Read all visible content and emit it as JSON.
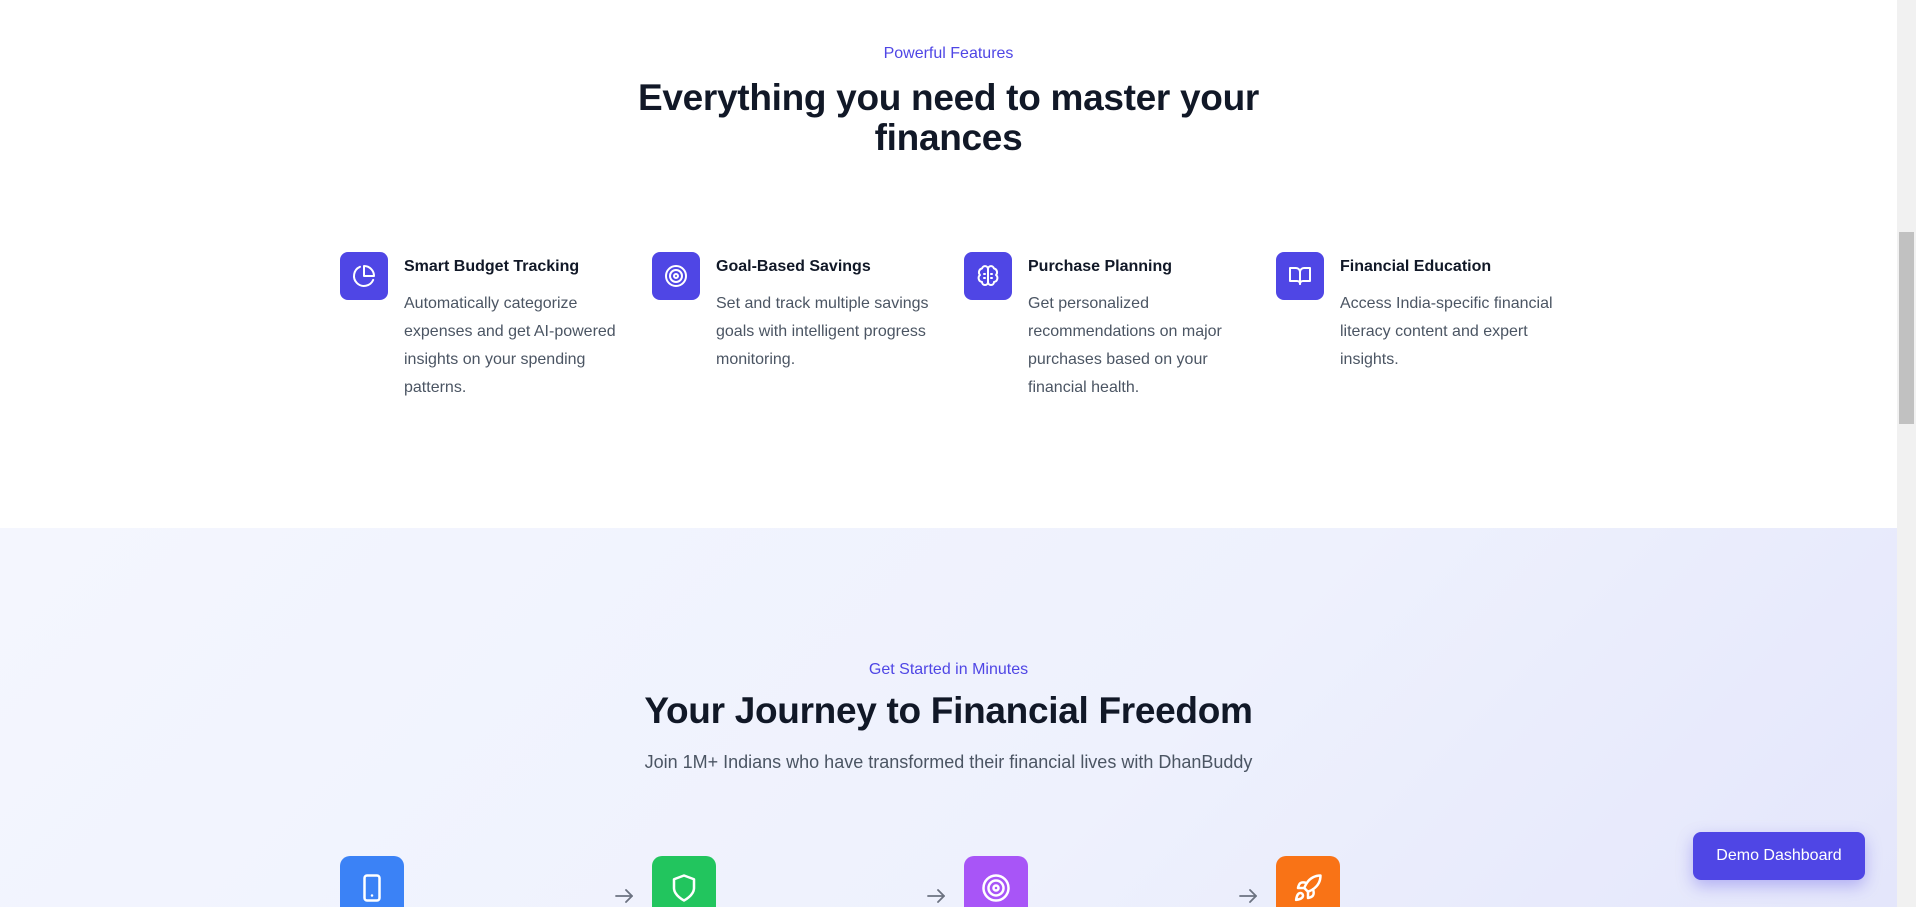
{
  "features_section": {
    "eyebrow": "Powerful Features",
    "title_line1": "Everything you need to master your",
    "title_line2": "finances",
    "items": [
      {
        "icon": "pie-chart-icon",
        "title": "Smart Budget Tracking",
        "description": "Automatically categorize expenses and get AI-powered insights on your spending patterns."
      },
      {
        "icon": "target-icon",
        "title": "Goal-Based Savings",
        "description": "Set and track multiple savings goals with intelligent progress monitoring."
      },
      {
        "icon": "brain-icon",
        "title": "Purchase Planning",
        "description": "Get personalized recommendations on major purchases based on your financial health."
      },
      {
        "icon": "book-open-icon",
        "title": "Financial Education",
        "description": "Access India-specific financial literacy content and expert insights."
      }
    ]
  },
  "journey_section": {
    "eyebrow": "Get Started in Minutes",
    "title": "Your Journey to Financial Freedom",
    "subtitle": "Join 1M+ Indians who have transformed their financial lives with DhanBuddy",
    "steps": [
      {
        "icon": "smartphone-icon",
        "color": "#3b82f6"
      },
      {
        "icon": "shield-icon",
        "color": "#22c55e"
      },
      {
        "icon": "target-icon",
        "color": "#a855f7"
      },
      {
        "icon": "rocket-icon",
        "color": "#f97316"
      }
    ]
  },
  "floating_button": {
    "label": "Demo Dashboard"
  },
  "colors": {
    "accent": "#4f46e5",
    "heading": "#111827",
    "body_text": "#4b5563"
  }
}
